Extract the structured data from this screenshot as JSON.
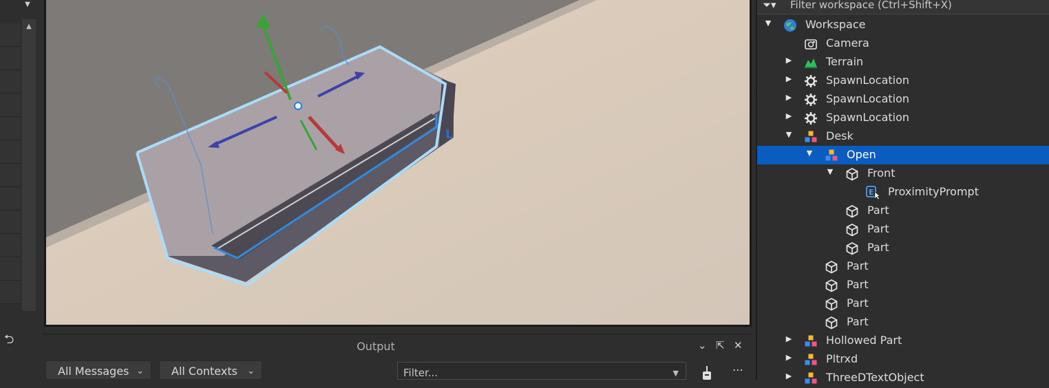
{
  "viewport": {
    "selected_label_marker": "L"
  },
  "output": {
    "title": "Output",
    "messages_filter": "All Messages",
    "contexts_filter": "All Contexts",
    "filter_placeholder": "Filter..."
  },
  "explorer": {
    "filter_placeholder": "Filter workspace (Ctrl+Shift+X)",
    "tree": [
      {
        "label": "Workspace",
        "icon": "workspace-icon",
        "depth": 0,
        "arrow": "expanded"
      },
      {
        "label": "Camera",
        "icon": "camera-icon",
        "depth": 1,
        "arrow": "none"
      },
      {
        "label": "Terrain",
        "icon": "terrain-icon",
        "depth": 1,
        "arrow": "collapsed"
      },
      {
        "label": "SpawnLocation",
        "icon": "spawn-location-icon",
        "depth": 1,
        "arrow": "collapsed"
      },
      {
        "label": "SpawnLocation",
        "icon": "spawn-location-icon",
        "depth": 1,
        "arrow": "collapsed"
      },
      {
        "label": "SpawnLocation",
        "icon": "spawn-location-icon",
        "depth": 1,
        "arrow": "collapsed"
      },
      {
        "label": "Desk",
        "icon": "model-icon",
        "depth": 1,
        "arrow": "expanded"
      },
      {
        "label": "Open",
        "icon": "model-icon",
        "depth": 2,
        "arrow": "expanded",
        "selected": true
      },
      {
        "label": "Front",
        "icon": "part-icon",
        "depth": 3,
        "arrow": "expanded"
      },
      {
        "label": "ProximityPrompt",
        "icon": "proximity-prompt-icon",
        "depth": 4,
        "arrow": "none"
      },
      {
        "label": "Part",
        "icon": "part-icon",
        "depth": 3,
        "arrow": "none"
      },
      {
        "label": "Part",
        "icon": "part-icon",
        "depth": 3,
        "arrow": "none"
      },
      {
        "label": "Part",
        "icon": "part-icon",
        "depth": 3,
        "arrow": "none"
      },
      {
        "label": "Part",
        "icon": "part-icon",
        "depth": 2,
        "arrow": "none"
      },
      {
        "label": "Part",
        "icon": "part-icon",
        "depth": 2,
        "arrow": "none"
      },
      {
        "label": "Part",
        "icon": "part-icon",
        "depth": 2,
        "arrow": "none"
      },
      {
        "label": "Part",
        "icon": "part-icon",
        "depth": 2,
        "arrow": "none"
      },
      {
        "label": "Hollowed Part",
        "icon": "model-icon",
        "depth": 1,
        "arrow": "collapsed"
      },
      {
        "label": "Pltrxd",
        "icon": "model-icon",
        "depth": 1,
        "arrow": "collapsed"
      },
      {
        "label": "ThreeDTextObject",
        "icon": "model-icon",
        "depth": 1,
        "arrow": "collapsed"
      }
    ]
  },
  "colors": {
    "selection": "#0b5cc1",
    "wall": "#7d7a78",
    "floor": "#d8c8b8",
    "selection_outline": "#a8dcf8",
    "move_handle_y": "#3aa335",
    "move_handle_x": "#b8393a",
    "move_handle_z": "#3b42a8"
  }
}
